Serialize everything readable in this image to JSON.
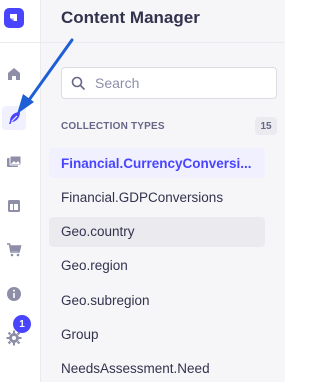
{
  "colors": {
    "accent": "#4945ff",
    "annotation_arrow": "#1f5fd6",
    "text_primary": "#32324d",
    "text_muted": "#666687"
  },
  "rail": {
    "icons": [
      {
        "name": "home-icon",
        "active": false
      },
      {
        "name": "content-manager-feather-icon",
        "active": true
      },
      {
        "name": "media-library-icon",
        "active": false
      },
      {
        "name": "layout-builder-icon",
        "active": false
      },
      {
        "name": "cart-icon",
        "active": false
      },
      {
        "name": "info-icon",
        "active": false
      },
      {
        "name": "settings-gear-icon",
        "active": false
      }
    ],
    "notification_count": "1"
  },
  "panel": {
    "title": "Content Manager",
    "search": {
      "placeholder": "Search",
      "value": ""
    },
    "section": {
      "title": "COLLECTION TYPES",
      "count": "15"
    },
    "items": [
      {
        "label": "Financial.CurrencyConversi...",
        "state": "active"
      },
      {
        "label": "Financial.GDPConversions",
        "state": "normal"
      },
      {
        "label": "Geo.country",
        "state": "hover"
      },
      {
        "label": "Geo.region",
        "state": "normal"
      },
      {
        "label": "Geo.subregion",
        "state": "normal"
      },
      {
        "label": "Group",
        "state": "normal"
      },
      {
        "label": "NeedsAssessment.Need",
        "state": "normal"
      }
    ]
  }
}
